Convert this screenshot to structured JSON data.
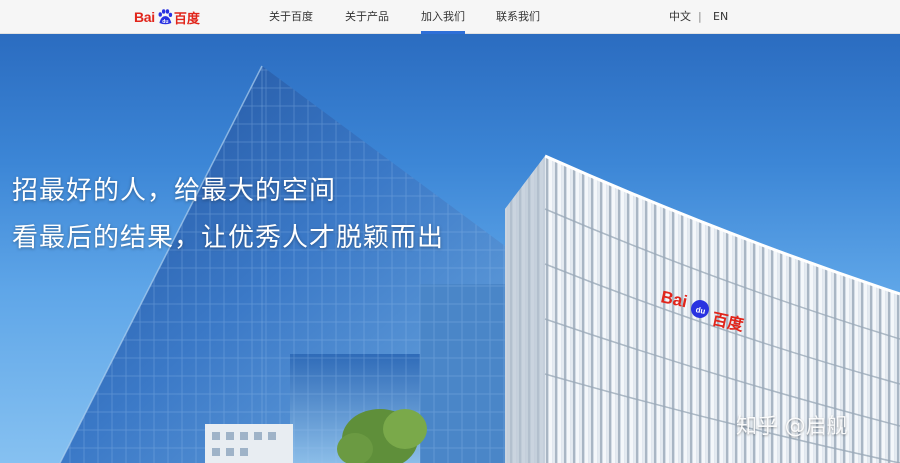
{
  "header": {
    "logo": {
      "text_latin": "Bai",
      "text_du": "du",
      "text_cn": "百度"
    },
    "nav": [
      {
        "label": "关于百度"
      },
      {
        "label": "关于产品"
      },
      {
        "label": "加入我们",
        "active": true
      },
      {
        "label": "联系我们"
      }
    ],
    "language": {
      "zh": "中文",
      "separator": "|",
      "en": "EN"
    }
  },
  "hero": {
    "slogan_line1": "招最好的人，给最大的空间",
    "slogan_line2": "看最后的结果，让优秀人才脱颖而出",
    "building_sign": {
      "text_latin": "Bai",
      "text_du": "du",
      "text_cn": "百度"
    }
  },
  "watermark": "知乎 @启舰",
  "colors": {
    "brand_red": "#e1251b",
    "brand_blue": "#2932e1",
    "nav_active": "#2e6fd8",
    "sky": "#3c86d6"
  }
}
